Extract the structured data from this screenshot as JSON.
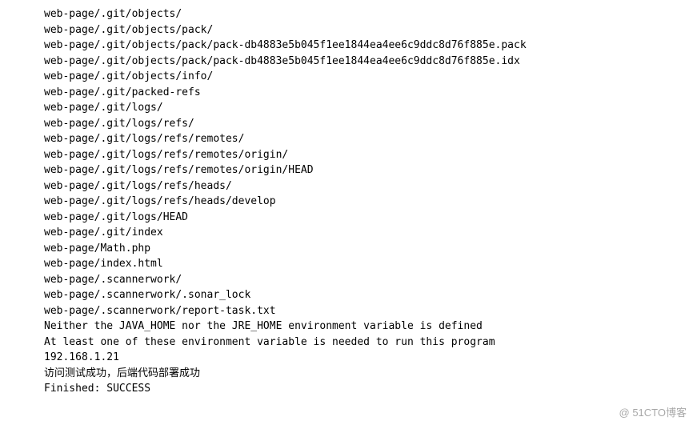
{
  "console": {
    "lines": [
      "web-page/.git/objects/",
      "web-page/.git/objects/pack/",
      "web-page/.git/objects/pack/pack-db4883e5b045f1ee1844ea4ee6c9ddc8d76f885e.pack",
      "web-page/.git/objects/pack/pack-db4883e5b045f1ee1844ea4ee6c9ddc8d76f885e.idx",
      "web-page/.git/objects/info/",
      "web-page/.git/packed-refs",
      "web-page/.git/logs/",
      "web-page/.git/logs/refs/",
      "web-page/.git/logs/refs/remotes/",
      "web-page/.git/logs/refs/remotes/origin/",
      "web-page/.git/logs/refs/remotes/origin/HEAD",
      "web-page/.git/logs/refs/heads/",
      "web-page/.git/logs/refs/heads/develop",
      "web-page/.git/logs/HEAD",
      "web-page/.git/index",
      "web-page/Math.php",
      "web-page/index.html",
      "web-page/.scannerwork/",
      "web-page/.scannerwork/.sonar_lock",
      "web-page/.scannerwork/report-task.txt",
      "Neither the JAVA_HOME nor the JRE_HOME environment variable is defined",
      "At least one of these environment variable is needed to run this program",
      "192.168.1.21",
      "访问测试成功，后端代码部署成功",
      "",
      "",
      "Finished: SUCCESS"
    ]
  },
  "watermark": "@ 51CTO博客"
}
